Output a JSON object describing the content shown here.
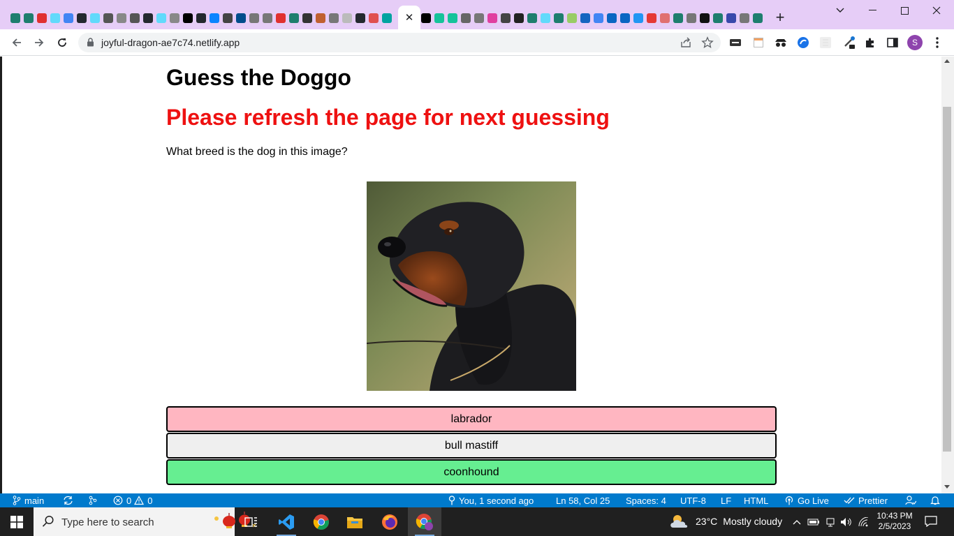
{
  "browser": {
    "url": "joyful-dragon-ae7c74.netlify.app",
    "active_tab_close": "✕",
    "new_tab": "+",
    "profile_initial": "S",
    "tab_icon_colors": [
      "#1e7e6e",
      "#1e7e6e",
      "#e03030",
      "#61dafb",
      "#4285f4",
      "#24292f",
      "#61dafb",
      "#555555",
      "#888888",
      "#555555",
      "#24292f",
      "#61dafb",
      "#888888",
      "#000000",
      "#24292f",
      "#0a84ff",
      "#444444",
      "#004d8c",
      "#777777",
      "#777777",
      "#e03030",
      "#1e7e6e",
      "#333333",
      "#c06030",
      "#777777",
      "#bbbbbb",
      "#24292f",
      "#e05050",
      "#00a3a0"
    ],
    "tab_icon_colors_right": [
      "#000000",
      "#15c39a",
      "#15c39a",
      "#666666",
      "#777777",
      "#e040a0",
      "#444444",
      "#222222",
      "#1e7e6e",
      "#61dafb",
      "#1e7e6e",
      "#9c6",
      "#1565c0",
      "#4285f4",
      "#0a66c2",
      "#0a66c2",
      "#2196f3",
      "#e53935",
      "#e07070",
      "#1e7e6e",
      "#777777",
      "#111111",
      "#1e7e6e",
      "#3949ab",
      "#777777",
      "#1e7e6e"
    ]
  },
  "page": {
    "title": "Guess the Doggo",
    "refresh_message": "Please refresh the page for next guessing",
    "question": "What breed is the dog in this image?",
    "answers": [
      {
        "label": "labrador",
        "state": "wrong",
        "color": "#ffb6c1"
      },
      {
        "label": "bull mastiff",
        "state": "neutral",
        "color": "#efefef"
      },
      {
        "label": "coonhound",
        "state": "correct",
        "color": "#66ee91"
      }
    ]
  },
  "statusbar": {
    "branch": "main",
    "errors": "0",
    "warnings": "0",
    "blame": "You, 1 second ago",
    "cursor": "Ln 58, Col 25",
    "spaces": "Spaces: 4",
    "encoding": "UTF-8",
    "eol": "LF",
    "language": "HTML",
    "golive": "Go Live",
    "prettier": "Prettier",
    "color": "#007acc"
  },
  "taskbar": {
    "search_placeholder": "Type here to search",
    "weather_temp": "23°C",
    "weather_desc": "Mostly cloudy",
    "time": "10:43 PM",
    "date": "2/5/2023"
  }
}
